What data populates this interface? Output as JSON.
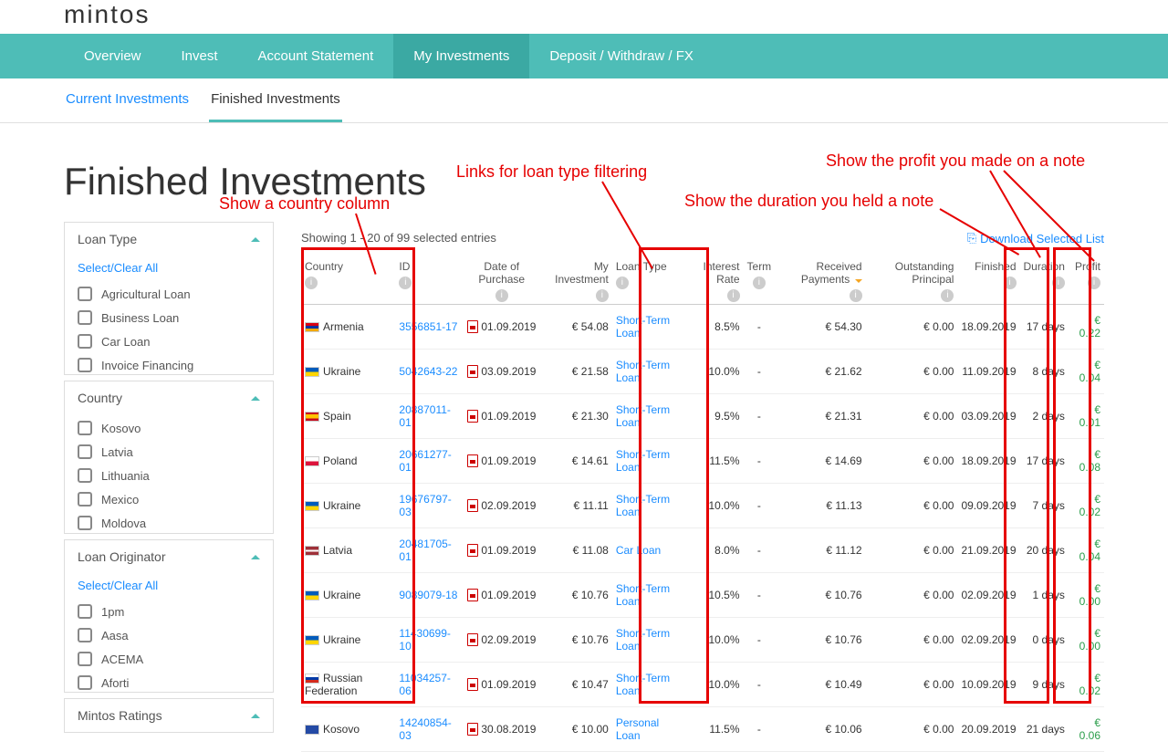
{
  "logo": "mintos",
  "topnav": [
    "Overview",
    "Invest",
    "Account Statement",
    "My Investments",
    "Deposit / Withdraw / FX"
  ],
  "topnav_active": 3,
  "subnav": [
    "Current Investments",
    "Finished Investments"
  ],
  "page_title": "Finished Investments",
  "showing": "Showing 1 - 20 of 99 selected entries",
  "download": "Download Selected List",
  "filters": {
    "loan_type": {
      "title": "Loan Type",
      "select_clear": "Select/Clear All",
      "opts": [
        "Agricultural Loan",
        "Business Loan",
        "Car Loan",
        "Invoice Financing"
      ]
    },
    "country": {
      "title": "Country",
      "opts": [
        "Kosovo",
        "Latvia",
        "Lithuania",
        "Mexico",
        "Moldova"
      ]
    },
    "originator": {
      "title": "Loan Originator",
      "select_clear": "Select/Clear All",
      "opts": [
        "1pm",
        "Aasa",
        "ACEMA",
        "Aforti"
      ]
    },
    "ratings": {
      "title": "Mintos Ratings"
    }
  },
  "cols": [
    "Country",
    "ID",
    "Date of Purchase",
    "My Investment",
    "Loan Type",
    "Interest Rate",
    "Term",
    "Received Payments",
    "Outstanding Principal",
    "Finished",
    "Duration",
    "Profit"
  ],
  "rows": [
    {
      "flag": "am",
      "country": "Armenia",
      "id": "3556851-17",
      "date": "01.09.2019",
      "inv": "€ 54.08",
      "type": "Short-Term Loan",
      "rate": "8.5%",
      "term": "-",
      "recv": "€ 54.30",
      "out": "€ 0.00",
      "fin": "18.09.2019",
      "dur": "17 days",
      "profit": "€ 0.22"
    },
    {
      "flag": "ua",
      "country": "Ukraine",
      "id": "5042643-22",
      "date": "03.09.2019",
      "inv": "€ 21.58",
      "type": "Short-Term Loan",
      "rate": "10.0%",
      "term": "-",
      "recv": "€ 21.62",
      "out": "€ 0.00",
      "fin": "11.09.2019",
      "dur": "8 days",
      "profit": "€ 0.04"
    },
    {
      "flag": "es",
      "country": "Spain",
      "id": "20887011-01",
      "date": "01.09.2019",
      "inv": "€ 21.30",
      "type": "Short-Term Loan",
      "rate": "9.5%",
      "term": "-",
      "recv": "€ 21.31",
      "out": "€ 0.00",
      "fin": "03.09.2019",
      "dur": "2 days",
      "profit": "€ 0.01"
    },
    {
      "flag": "pl",
      "country": "Poland",
      "id": "20661277-01",
      "date": "01.09.2019",
      "inv": "€ 14.61",
      "type": "Short-Term Loan",
      "rate": "11.5%",
      "term": "-",
      "recv": "€ 14.69",
      "out": "€ 0.00",
      "fin": "18.09.2019",
      "dur": "17 days",
      "profit": "€ 0.08"
    },
    {
      "flag": "ua",
      "country": "Ukraine",
      "id": "19676797-03",
      "date": "02.09.2019",
      "inv": "€ 11.11",
      "type": "Short-Term Loan",
      "rate": "10.0%",
      "term": "-",
      "recv": "€ 11.13",
      "out": "€ 0.00",
      "fin": "09.09.2019",
      "dur": "7 days",
      "profit": "€ 0.02"
    },
    {
      "flag": "lv",
      "country": "Latvia",
      "id": "20481705-01",
      "date": "01.09.2019",
      "inv": "€ 11.08",
      "type": "Car Loan",
      "rate": "8.0%",
      "term": "-",
      "recv": "€ 11.12",
      "out": "€ 0.00",
      "fin": "21.09.2019",
      "dur": "20 days",
      "profit": "€ 0.04"
    },
    {
      "flag": "ua",
      "country": "Ukraine",
      "id": "9089079-18",
      "date": "01.09.2019",
      "inv": "€ 10.76",
      "type": "Short-Term Loan",
      "rate": "10.5%",
      "term": "-",
      "recv": "€ 10.76",
      "out": "€ 0.00",
      "fin": "02.09.2019",
      "dur": "1 days",
      "profit": "€ 0.00"
    },
    {
      "flag": "ua",
      "country": "Ukraine",
      "id": "11430699-10",
      "date": "02.09.2019",
      "inv": "€ 10.76",
      "type": "Short-Term Loan",
      "rate": "10.0%",
      "term": "-",
      "recv": "€ 10.76",
      "out": "€ 0.00",
      "fin": "02.09.2019",
      "dur": "0 days",
      "profit": "€ 0.00"
    },
    {
      "flag": "ru",
      "country": "Russian Federation",
      "id": "11034257-06",
      "date": "01.09.2019",
      "inv": "€ 10.47",
      "type": "Short-Term Loan",
      "rate": "10.0%",
      "term": "-",
      "recv": "€ 10.49",
      "out": "€ 0.00",
      "fin": "10.09.2019",
      "dur": "9 days",
      "profit": "€ 0.02"
    },
    {
      "flag": "xk",
      "country": "Kosovo",
      "id": "14240854-03",
      "date": "30.08.2019",
      "inv": "€ 10.00",
      "type": "Personal Loan",
      "rate": "11.5%",
      "term": "-",
      "recv": "€ 10.06",
      "out": "€ 0.00",
      "fin": "20.09.2019",
      "dur": "21 days",
      "profit": "€ 0.06"
    }
  ],
  "annotations": {
    "country": "Show a country column",
    "loantype": "Links for loan type filtering",
    "duration": "Show the duration you held a note",
    "profit": "Show the profit you made on a note"
  }
}
